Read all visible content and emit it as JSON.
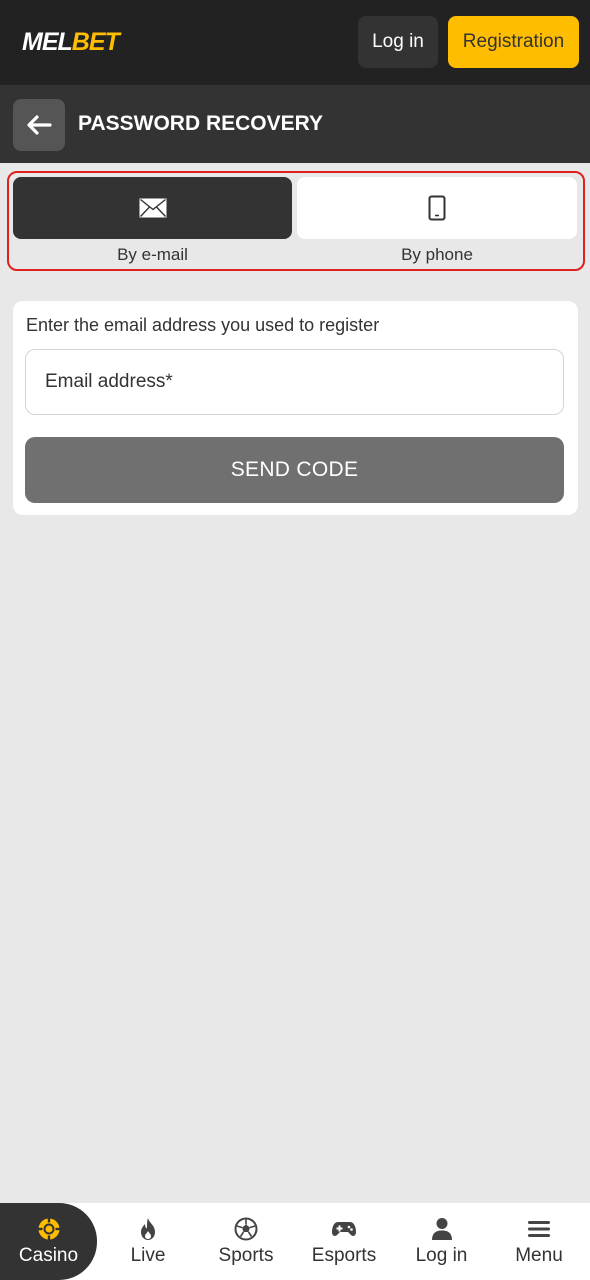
{
  "topbar": {
    "logo_part1": "MEL",
    "logo_part2": "BET",
    "login_label": "Log in",
    "registration_label": "Registration"
  },
  "header": {
    "title": "PASSWORD RECOVERY"
  },
  "recovery_methods": {
    "selected": "By e-mail",
    "tabs": [
      {
        "label": "By e-mail",
        "icon": "envelope-icon"
      },
      {
        "label": "By phone",
        "icon": "smartphone-icon"
      }
    ]
  },
  "form": {
    "hint": "Enter the email address you used to register",
    "email_placeholder": "Email address*",
    "email_value": "",
    "send_label": "SEND CODE"
  },
  "bottom_nav": {
    "active": "Casino",
    "items": [
      {
        "label": "Casino",
        "icon": "casino-chip-icon"
      },
      {
        "label": "Live",
        "icon": "flame-icon"
      },
      {
        "label": "Sports",
        "icon": "soccer-ball-icon"
      },
      {
        "label": "Esports",
        "icon": "gamepad-icon"
      },
      {
        "label": "Log in",
        "icon": "user-icon"
      },
      {
        "label": "Menu",
        "icon": "hamburger-menu-icon"
      }
    ]
  },
  "colors": {
    "brand_yellow": "#ffbd00",
    "dark": "#222222",
    "header": "#333333",
    "background": "#e8e8e8",
    "highlight_border": "#e02020",
    "send_button": "#707070"
  }
}
